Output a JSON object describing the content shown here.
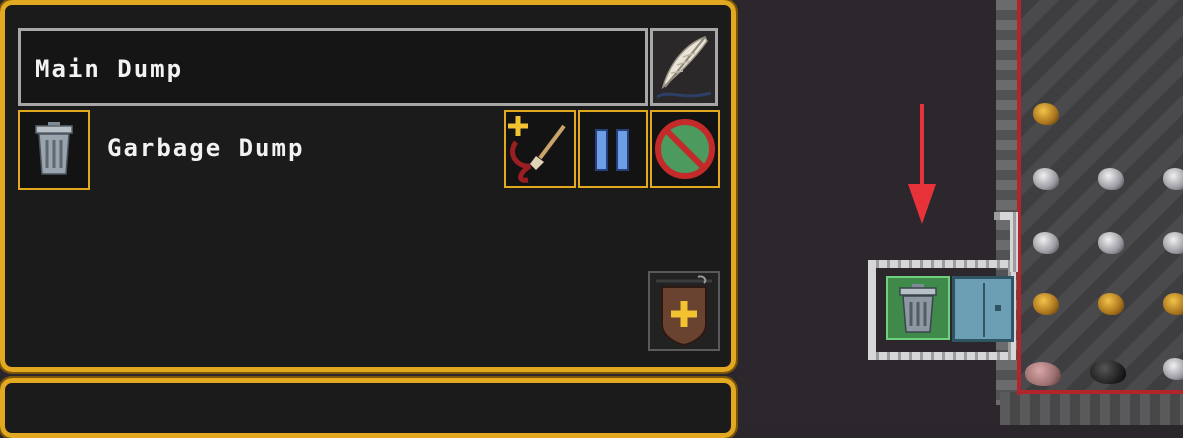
{
  "stockpile": {
    "name": "Main Dump",
    "zone_type_label": "Garbage Dump"
  },
  "icons": {
    "rename": "quill-icon",
    "zone_type": "trash-can-icon",
    "paint_zone": "paint-brush-plus-icon",
    "suspend": "pause-icon",
    "remove": "prohibited-icon",
    "add_location": "shield-plus-sign-icon"
  },
  "map": {
    "marker": "red-down-arrow",
    "tiles": [
      "garbage-dump-tile",
      "door-tile",
      "stone-wall",
      "rough-stone",
      "gold-ore",
      "silver-ore",
      "rose-stone",
      "coal"
    ]
  },
  "colors": {
    "panel_border": "#e2a81f",
    "panel_bg": "#1c1b1c",
    "marker": "#e8323a",
    "zone_green": "#3f8a4a"
  }
}
